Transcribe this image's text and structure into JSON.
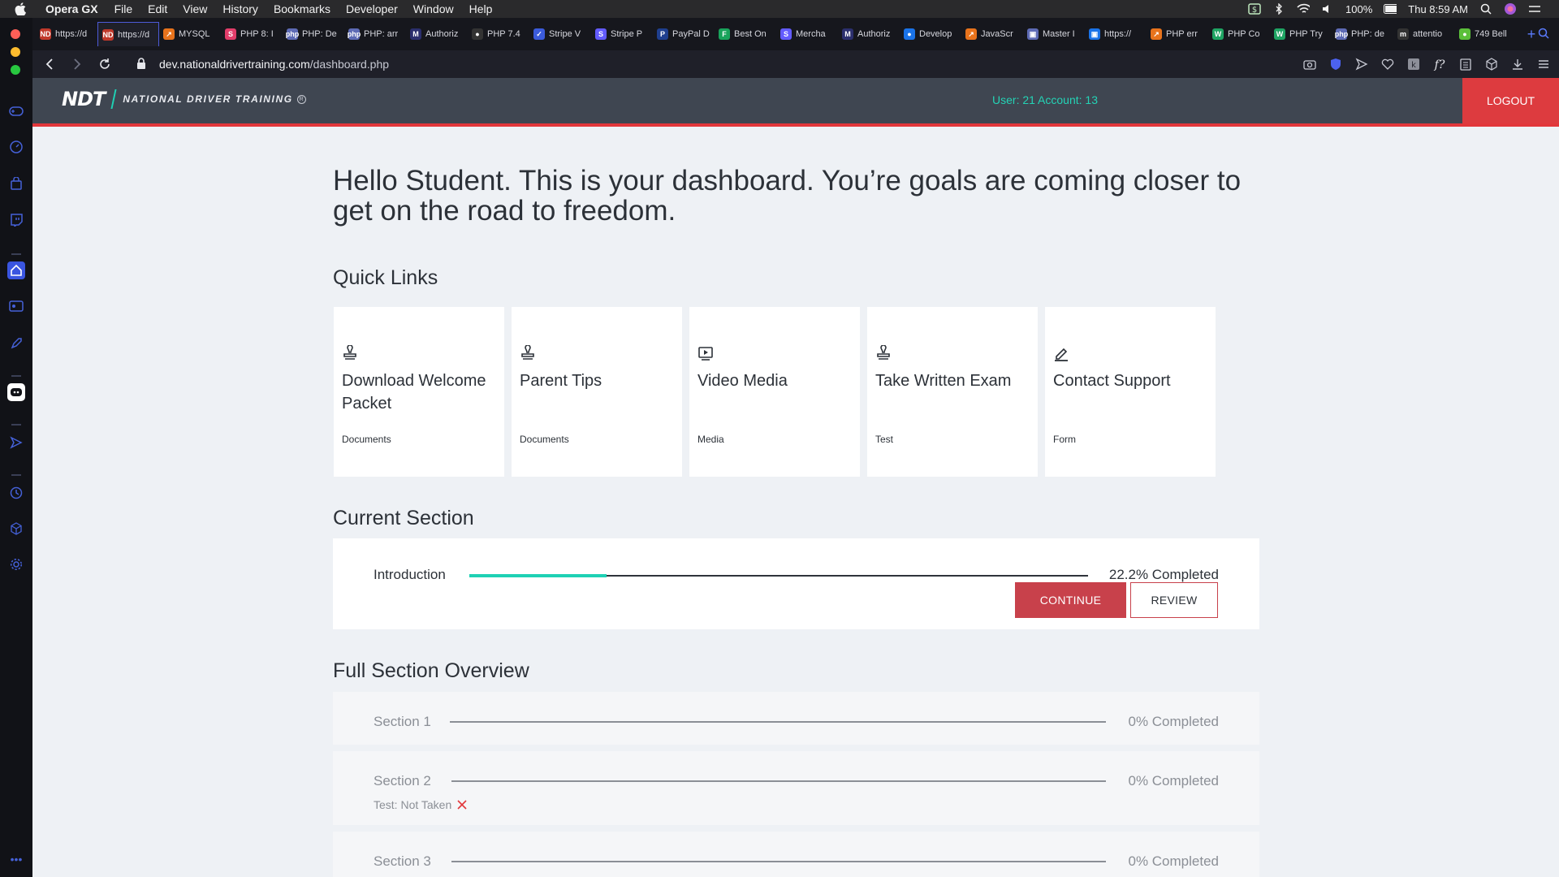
{
  "menubar": {
    "app_name": "Opera GX",
    "items": [
      "File",
      "Edit",
      "View",
      "History",
      "Bookmarks",
      "Developer",
      "Window",
      "Help"
    ],
    "battery": "100%",
    "clock": "Thu 8:59 AM"
  },
  "tabs": [
    {
      "title": "https://d",
      "color": "#c0392b",
      "glyph": "ND"
    },
    {
      "title": "https://d",
      "color": "#c0392b",
      "glyph": "ND",
      "active": true
    },
    {
      "title": "MYSQL",
      "color": "#e8731c",
      "glyph": "↗"
    },
    {
      "title": "PHP 8: I",
      "color": "#e23d6a",
      "glyph": "S"
    },
    {
      "title": "PHP: De",
      "color": "#5e6bb5",
      "glyph": "php"
    },
    {
      "title": "PHP: arr",
      "color": "#5e6bb5",
      "glyph": "php"
    },
    {
      "title": "Authoriz",
      "color": "#2b2f6d",
      "glyph": "M"
    },
    {
      "title": "PHP 7.4",
      "color": "#333",
      "glyph": "●"
    },
    {
      "title": "Stripe V",
      "color": "#3b5bdb",
      "glyph": "✓"
    },
    {
      "title": "Stripe P",
      "color": "#635bff",
      "glyph": "S"
    },
    {
      "title": "PayPal D",
      "color": "#1f3f8f",
      "glyph": "P"
    },
    {
      "title": "Best On",
      "color": "#19a35b",
      "glyph": "F"
    },
    {
      "title": "Mercha",
      "color": "#635bff",
      "glyph": "S"
    },
    {
      "title": "Authoriz",
      "color": "#2b2f6d",
      "glyph": "M"
    },
    {
      "title": "Develop",
      "color": "#1a73e8",
      "glyph": "●"
    },
    {
      "title": "JavaScr",
      "color": "#e8731c",
      "glyph": "↗"
    },
    {
      "title": "Master I",
      "color": "#5e6bb5",
      "glyph": "▣"
    },
    {
      "title": "https://",
      "color": "#1a73e8",
      "glyph": "▣"
    },
    {
      "title": "PHP err",
      "color": "#e8731c",
      "glyph": "↗"
    },
    {
      "title": "PHP Co",
      "color": "#1fa463",
      "glyph": "W"
    },
    {
      "title": "PHP Try",
      "color": "#1fa463",
      "glyph": "W"
    },
    {
      "title": "PHP: de",
      "color": "#5e6bb5",
      "glyph": "php"
    },
    {
      "title": "attentio",
      "color": "#333",
      "glyph": "m"
    },
    {
      "title": "749 Bell",
      "color": "#5bbf3a",
      "glyph": "●"
    }
  ],
  "address": {
    "host": "dev.nationaldrivertraining.com",
    "path": "/dashboard.php"
  },
  "site": {
    "logo_mark": "NDT",
    "logo_name": "NATIONAL DRIVER TRAINING",
    "logo_reg": "R",
    "user_info": "User: 21 Account: 13",
    "logout_label": "LOGOUT"
  },
  "dashboard": {
    "greeting": "Hello Student. This is your dashboard. You’re goals are coming closer to get on the road to freedom.",
    "quick_links_heading": "Quick Links",
    "quick_links": [
      {
        "title": "Download Welcome Packet",
        "category": "Documents",
        "icon": "stamp-icon"
      },
      {
        "title": "Parent Tips",
        "category": "Documents",
        "icon": "stamp-icon"
      },
      {
        "title": "Video Media",
        "category": "Media",
        "icon": "video-play-icon"
      },
      {
        "title": "Take Written Exam",
        "category": "Test",
        "icon": "stamp-icon"
      },
      {
        "title": "Contact Support",
        "category": "Form",
        "icon": "pencil-icon"
      }
    ],
    "current_section_heading": "Current Section",
    "current_section": {
      "label": "Introduction",
      "progress_percent": 22.2,
      "progress_text": "22.2% Completed",
      "continue_label": "CONTINUE",
      "review_label": "REVIEW"
    },
    "overview_heading": "Full Section Overview",
    "sections": [
      {
        "label": "Section 1",
        "progress_text": "0% Completed",
        "progress_percent": 0,
        "test_status": ""
      },
      {
        "label": "Section 2",
        "progress_text": "0% Completed",
        "progress_percent": 0,
        "test_status": "Test: Not Taken"
      },
      {
        "label": "Section 3",
        "progress_text": "0% Completed",
        "progress_percent": 0,
        "test_status": ""
      }
    ]
  },
  "colors": {
    "accent_teal": "#1fd1b4",
    "accent_red": "#dd3b3f",
    "header_bg": "#3f4651"
  }
}
